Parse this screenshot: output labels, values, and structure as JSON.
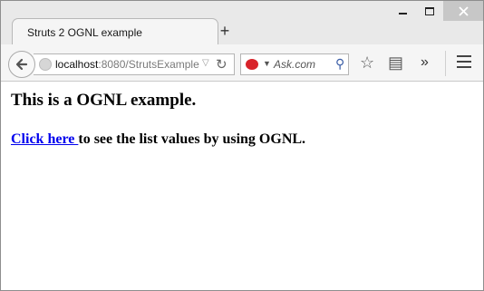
{
  "browser": {
    "tab_title": "Struts 2 OGNL example",
    "new_tab_glyph": "+",
    "url_host": "localhost",
    "url_rest": ":8080/StrutsExample",
    "search_placeholder": "Ask.com",
    "icons": {
      "back": "back-arrow-icon",
      "site": "globe-icon",
      "reload": "reload-icon",
      "search_engine": "ask-logo-icon",
      "search": "magnifier-icon",
      "bookmark": "star-icon",
      "reading_list": "clipboard-icon",
      "overflow": "double-chevron-icon",
      "menu": "hamburger-menu-icon"
    }
  },
  "page": {
    "heading": "This is a OGNL example.",
    "link_text": "Click here ",
    "link_suffix": "to see the list values by using OGNL.",
    "link_color": "#0000ee"
  }
}
